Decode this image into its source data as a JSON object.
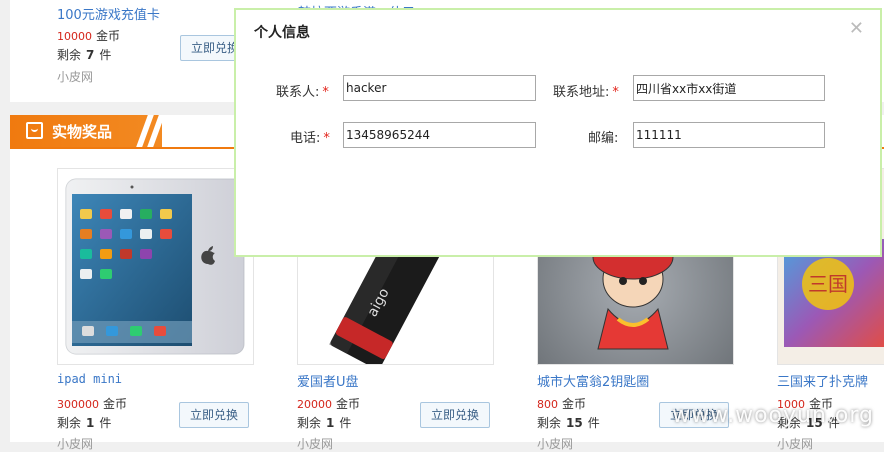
{
  "top_items": [
    {
      "name": "100元游戏充值卡",
      "price": "10000",
      "coin": "金币",
      "remain_label": "剩余",
      "remain_count": "7",
      "remain_unit": "件",
      "vendor": "小皮网",
      "button": "立即兑换"
    },
    {
      "name": "韩拉西游香港—什元"
    }
  ],
  "section": {
    "title": "实物奖品",
    "icon": "shopping-bag-icon"
  },
  "products": [
    {
      "name": "ipad mini",
      "price": "300000",
      "coin": "金币",
      "remain_label": "剩余",
      "remain_count": "1",
      "remain_unit": "件",
      "vendor": "小皮网",
      "button": "立即兑换"
    },
    {
      "name": "爱国者U盘",
      "price": "20000",
      "coin": "金币",
      "remain_label": "剩余",
      "remain_count": "1",
      "remain_unit": "件",
      "vendor": "小皮网",
      "button": "立即兑换"
    },
    {
      "name": "城市大富翁2钥匙圈",
      "price": "800",
      "coin": "金币",
      "remain_label": "剩余",
      "remain_count": "15",
      "remain_unit": "件",
      "vendor": "小皮网",
      "button": "立即兑换"
    },
    {
      "name": "三国来了扑克牌",
      "price": "1000",
      "coin": "金币",
      "remain_label": "剩余",
      "remain_count": "15",
      "remain_unit": "件",
      "vendor": "小皮网"
    }
  ],
  "modal": {
    "title": "个人信息",
    "close_icon": "close-icon",
    "fields": {
      "contact": {
        "label": "联系人:",
        "value": "hacker"
      },
      "address": {
        "label": "联系地址:",
        "value": "四川省xx市xx街道"
      },
      "phone": {
        "label": "电话:",
        "value": "13458965244"
      },
      "postcode": {
        "label": "邮编:",
        "value": "111111"
      }
    },
    "required_mark": "*"
  },
  "watermark": "www.wooyun.org",
  "colors": {
    "accent": "#f07a0f",
    "link": "#3a77c7",
    "price": "#d4261c",
    "modal_border": "#c9efa9"
  }
}
